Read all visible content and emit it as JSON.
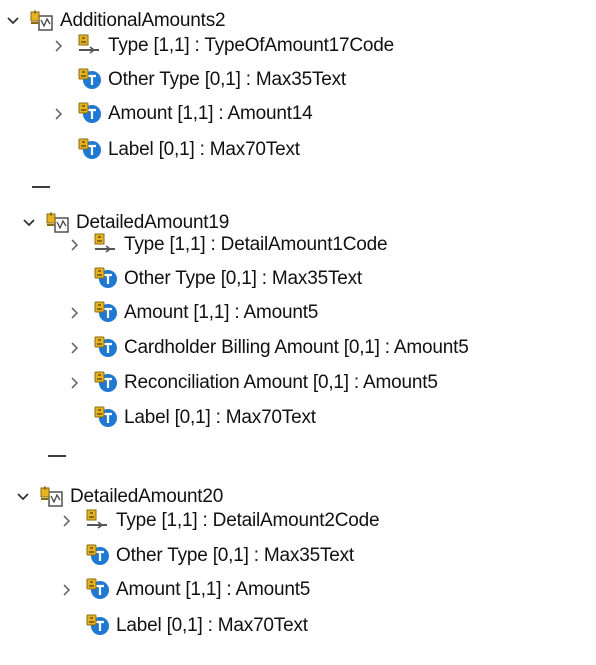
{
  "tree": [
    {
      "name": "AdditionalAmounts2",
      "expanded": true,
      "icon": "message-component-icon",
      "children": [
        {
          "label": "Type [1,1] : TypeOfAmount17Code",
          "icon": "code-element-icon",
          "expandable": true
        },
        {
          "label": "Other Type [0,1] : Max35Text",
          "icon": "text-element-icon",
          "expandable": false
        },
        {
          "label": "Amount [1,1] : Amount14",
          "icon": "text-element-icon",
          "expandable": true
        },
        {
          "label": "Label [0,1] : Max70Text",
          "icon": "text-element-icon",
          "expandable": false
        }
      ]
    },
    {
      "name": "DetailedAmount19",
      "expanded": true,
      "icon": "message-component-icon",
      "children": [
        {
          "label": "Type [1,1] : DetailAmount1Code",
          "icon": "code-element-icon",
          "expandable": true
        },
        {
          "label": "Other Type [0,1] : Max35Text",
          "icon": "text-element-icon",
          "expandable": false
        },
        {
          "label": "Amount [1,1] : Amount5",
          "icon": "text-element-icon",
          "expandable": true
        },
        {
          "label": "Cardholder Billing Amount [0,1] : Amount5",
          "icon": "text-element-icon",
          "expandable": true
        },
        {
          "label": "Reconciliation Amount [0,1] : Amount5",
          "icon": "text-element-icon",
          "expandable": true
        },
        {
          "label": "Label [0,1] : Max70Text",
          "icon": "text-element-icon",
          "expandable": false
        }
      ]
    },
    {
      "name": "DetailedAmount20",
      "expanded": true,
      "icon": "message-component-icon",
      "children": [
        {
          "label": "Type [1,1] : DetailAmount2Code",
          "icon": "code-element-icon",
          "expandable": true
        },
        {
          "label": "Other Type [0,1] : Max35Text",
          "icon": "text-element-icon",
          "expandable": false
        },
        {
          "label": "Amount [1,1] : Amount5",
          "icon": "text-element-icon",
          "expandable": true
        },
        {
          "label": "Label [0,1] : Max70Text",
          "icon": "text-element-icon",
          "expandable": false
        }
      ]
    }
  ],
  "colors": {
    "chevron": "#6b6b6b",
    "chevron_expanded": "#333333",
    "element_icon_blue": "#1f78d1",
    "element_icon_gold": "#e6b422"
  }
}
